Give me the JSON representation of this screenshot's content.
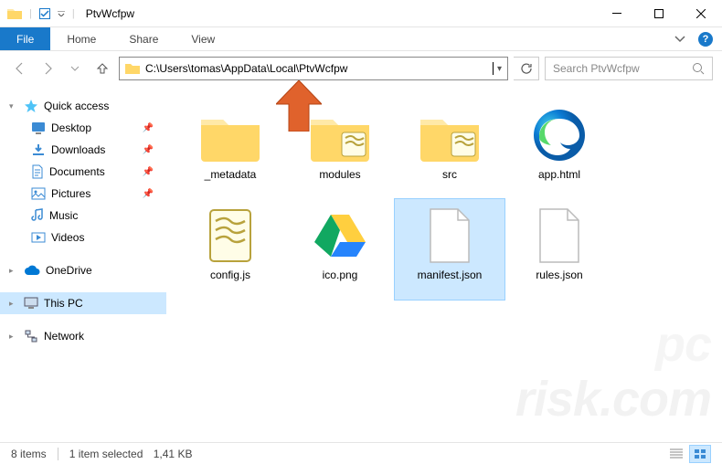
{
  "window": {
    "title": "PtvWcfpw"
  },
  "ribbon": {
    "file": "File",
    "tabs": [
      "Home",
      "Share",
      "View"
    ]
  },
  "address": {
    "path": "C:\\Users\\tomas\\AppData\\Local\\PtvWcfpw"
  },
  "search": {
    "placeholder": "Search PtvWcfpw"
  },
  "sidebar": {
    "quick_access": "Quick access",
    "quick_items": [
      {
        "label": "Desktop",
        "icon": "desktop"
      },
      {
        "label": "Downloads",
        "icon": "downloads"
      },
      {
        "label": "Documents",
        "icon": "documents"
      },
      {
        "label": "Pictures",
        "icon": "pictures"
      },
      {
        "label": "Music",
        "icon": "music"
      },
      {
        "label": "Videos",
        "icon": "videos"
      }
    ],
    "onedrive": "OneDrive",
    "this_pc": "This PC",
    "network": "Network"
  },
  "files": [
    {
      "name": "_metadata",
      "type": "folder",
      "selected": false
    },
    {
      "name": "modules",
      "type": "folder-script",
      "selected": false
    },
    {
      "name": "src",
      "type": "folder-script",
      "selected": false
    },
    {
      "name": "app.html",
      "type": "edge",
      "selected": false
    },
    {
      "name": "config.js",
      "type": "script",
      "selected": false
    },
    {
      "name": "ico.png",
      "type": "drive-img",
      "selected": false
    },
    {
      "name": "manifest.json",
      "type": "blank",
      "selected": true
    },
    {
      "name": "rules.json",
      "type": "blank",
      "selected": false
    }
  ],
  "status": {
    "count": "8 items",
    "selection": "1 item selected",
    "size": "1,41 KB"
  },
  "watermark": "risk.com",
  "watermark2": "pc"
}
